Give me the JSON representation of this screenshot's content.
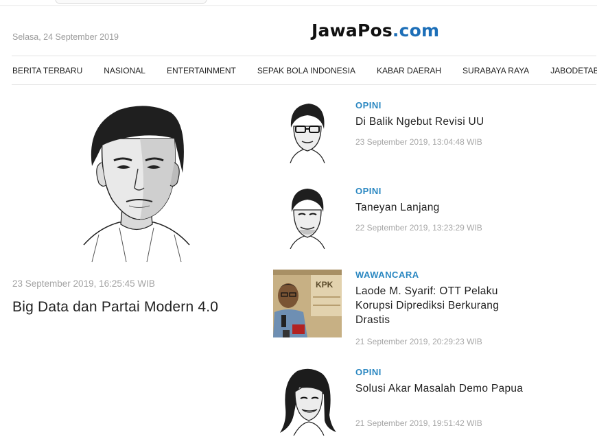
{
  "header": {
    "date": "Selasa, 24 September 2019",
    "logo_main": "JawaPos",
    "logo_suffix": ".com"
  },
  "nav": {
    "items": [
      "BERITA TERBARU",
      "NASIONAL",
      "ENTERTAINMENT",
      "SEPAK BOLA INDONESIA",
      "KABAR DAERAH",
      "SURABAYA RAYA",
      "JABODETABEK"
    ]
  },
  "featured": {
    "timestamp": "23 September 2019, 16:25:45 WIB",
    "title": "Big Data dan Partai Modern 4.0",
    "image": "portrait-sketch-illustration"
  },
  "articles": [
    {
      "category": "OPINI",
      "title": "Di Balik Ngebut Revisi UU",
      "timestamp": "23 September 2019, 13:04:48 WIB",
      "image": "caricature-glasses-man"
    },
    {
      "category": "OPINI",
      "title": "Taneyan Lanjang",
      "timestamp": "22 September 2019, 13:23:29 WIB",
      "image": "caricature-man-short-hair"
    },
    {
      "category": "WAWANCARA",
      "title": "Laode M. Syarif: OTT Pelaku Korupsi Diprediksi Berkurang Drastis",
      "timestamp": "21 September 2019, 20:29:23 WIB",
      "image": "photo-man-kpk-microphones"
    },
    {
      "category": "OPINI",
      "title": "Solusi Akar Masalah Demo Papua",
      "timestamp": "21 September 2019, 19:51:42 WIB",
      "image": "caricature-woman-long-hair"
    }
  ],
  "colors": {
    "category": "#2a87c1",
    "logo_suffix": "#1d6fb8",
    "muted_text": "#a6a6a6"
  }
}
